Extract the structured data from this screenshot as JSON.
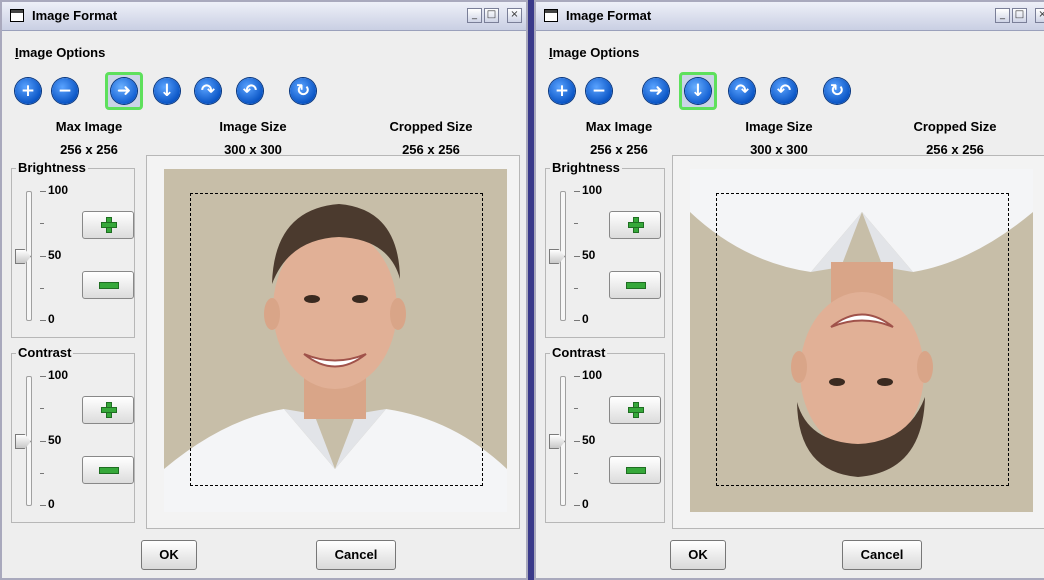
{
  "windows": [
    {
      "title": "Image Format",
      "menu": "Image Options",
      "headers": {
        "max_image": "Max Image",
        "image_size": "Image Size",
        "cropped_size": "Cropped Size"
      },
      "values": {
        "max_image": "256 x 256",
        "image_size": "300 x 300",
        "cropped_size": "256 x 256"
      },
      "selected_tool": "rotate-right",
      "orientation": "upright",
      "brightness": {
        "label": "Brightness",
        "max": "100",
        "mid": "50",
        "min": "0",
        "value": 50
      },
      "contrast": {
        "label": "Contrast",
        "max": "100",
        "mid": "50",
        "min": "0",
        "value": 50
      },
      "ok_label": "OK",
      "cancel_label": "Cancel"
    },
    {
      "title": "Image Format",
      "menu": "Image Options",
      "headers": {
        "max_image": "Max Image",
        "image_size": "Image Size",
        "cropped_size": "Cropped Size"
      },
      "values": {
        "max_image": "256 x 256",
        "image_size": "300 x 300",
        "cropped_size": "256 x 256"
      },
      "selected_tool": "rotate-down",
      "orientation": "upside-down",
      "brightness": {
        "label": "Brightness",
        "max": "100",
        "mid": "50",
        "min": "0",
        "value": 50
      },
      "contrast": {
        "label": "Contrast",
        "max": "100",
        "mid": "50",
        "min": "0",
        "value": 50
      },
      "ok_label": "OK",
      "cancel_label": "Cancel"
    }
  ],
  "tools": [
    {
      "name": "zoom-in-icon",
      "glyph": "+"
    },
    {
      "name": "zoom-out-icon",
      "glyph": "−"
    },
    {
      "name": "rotate-right-icon",
      "glyph": "➜"
    },
    {
      "name": "rotate-down-icon",
      "glyph": "↓"
    },
    {
      "name": "flip-icon",
      "glyph": "↷"
    },
    {
      "name": "undo-icon",
      "glyph": "↶"
    },
    {
      "name": "reset-icon",
      "glyph": "↻"
    }
  ],
  "colors": {
    "selection_highlight": "#5ee05c",
    "tool_blue": "#0b56c6",
    "adjust_green": "#36a83a"
  }
}
